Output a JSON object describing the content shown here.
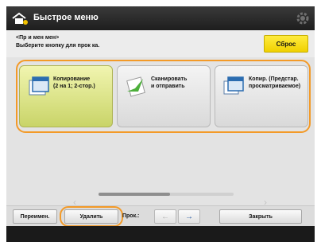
{
  "header": {
    "title": "Быстрое меню",
    "colors": {
      "bar": "#2b2b2b",
      "text": "#ffffff"
    }
  },
  "instruction": {
    "title": "<Пр и мен мен>",
    "subtitle": "Выберите кнопку для прок ка.",
    "reset_label": "Сброс"
  },
  "tiles": [
    {
      "label_line1": "Копирование",
      "label_line2": "(2 на 1; 2-стор.)",
      "selected": true
    },
    {
      "label_line1": "Сканировать",
      "label_line2": "и отправить",
      "selected": false
    },
    {
      "label_line1": "Копир. (Предстар.",
      "label_line2": "просматриваемое)",
      "selected": false
    }
  ],
  "bottom": {
    "move_label": "Переимен.",
    "delete_label": "Удалить",
    "order_label": "Прок.:",
    "left_arrow": "←",
    "right_arrow": "→",
    "close_label": "Закрыть"
  },
  "colors": {
    "accent_highlight": "#f39a28",
    "selected_tile": "#dde486",
    "reset_button": "#f6dc16"
  }
}
